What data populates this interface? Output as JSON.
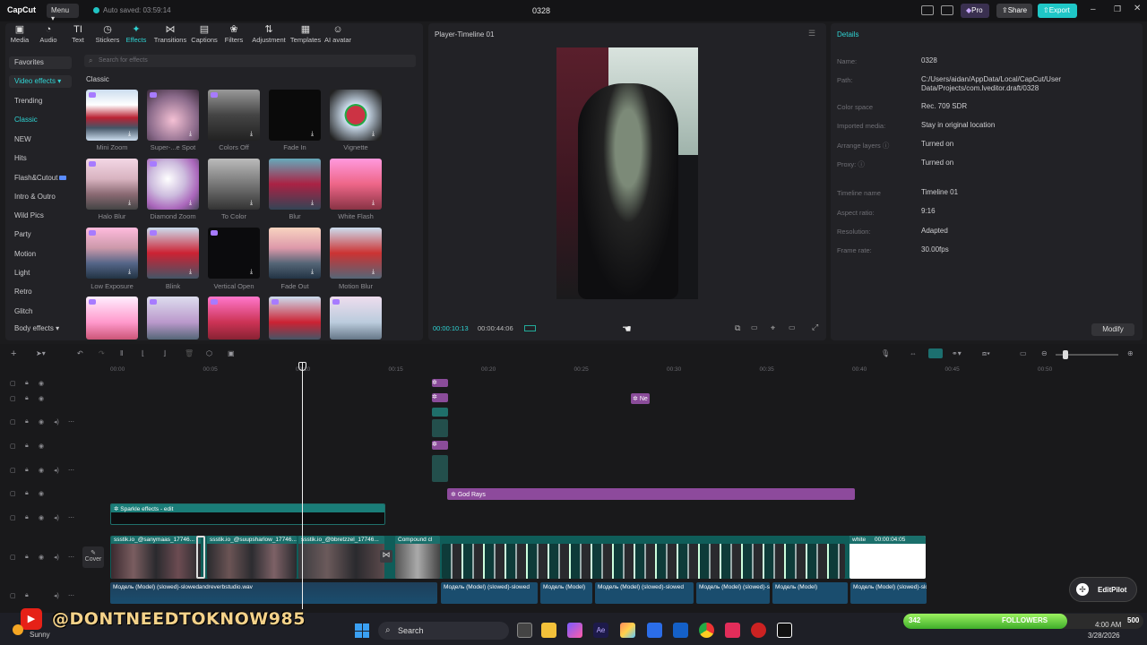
{
  "app": {
    "logo": "CapCut",
    "menu_label": "Menu",
    "autosave": "Auto saved: 03:59:14",
    "project_title": "0328",
    "pro_label": "Pro",
    "share_label": "Share",
    "export_label": "Export"
  },
  "toolbar": [
    {
      "label": "Media",
      "icon": "media-icon"
    },
    {
      "label": "Audio",
      "icon": "audio-icon"
    },
    {
      "label": "Text",
      "icon": "text-icon"
    },
    {
      "label": "Stickers",
      "icon": "stickers-icon"
    },
    {
      "label": "Effects",
      "icon": "effects-icon"
    },
    {
      "label": "Transitions",
      "icon": "transitions-icon"
    },
    {
      "label": "Captions",
      "icon": "captions-icon"
    },
    {
      "label": "Filters",
      "icon": "filters-icon"
    },
    {
      "label": "Adjustment",
      "icon": "adjustment-icon"
    },
    {
      "label": "Templates",
      "icon": "templates-icon"
    },
    {
      "label": "AI avatar",
      "icon": "ai-avatar-icon"
    }
  ],
  "sidebar": [
    "Favorites",
    "Video effects",
    "Trending",
    "Classic",
    "NEW",
    "Hits",
    "Flash&Cutout",
    "Intro & Outro",
    "Wild Pics",
    "Party",
    "Motion",
    "Light",
    "Retro",
    "Glitch",
    "Body effects"
  ],
  "effects": {
    "search_placeholder": "Search for effects",
    "section": "Classic",
    "items": [
      "Mini Zoom",
      "Super-...e Spot",
      "Colors Off",
      "Fade In",
      "Vignette",
      "Halo Blur",
      "Diamond Zoom",
      "To Color",
      "Blur",
      "White Flash",
      "Low Exposure",
      "Blink",
      "Vertical Open",
      "Fade Out",
      "Motion Blur",
      "",
      "",
      "",
      "",
      ""
    ]
  },
  "player": {
    "title": "Player-Timeline 01",
    "current_time": "00:00:10:13",
    "total_time": "00:00:44:06"
  },
  "details": {
    "title": "Details",
    "rows": [
      {
        "k": "Name:",
        "v": "0328"
      },
      {
        "k": "Path:",
        "v": "C:/Users/aidan/AppData/Local/CapCut/User Data/Projects/com.lveditor.draft/0328"
      },
      {
        "k": "Color space",
        "v": "Rec. 709 SDR"
      },
      {
        "k": "Imported media:",
        "v": "Stay in original location"
      },
      {
        "k": "Arrange layers",
        "v": "Turned on"
      },
      {
        "k": "Proxy:",
        "v": "Turned on"
      },
      {
        "k": "Timeline name",
        "v": "Timeline 01"
      },
      {
        "k": "Aspect ratio:",
        "v": "9:16"
      },
      {
        "k": "Resolution:",
        "v": "Adapted"
      },
      {
        "k": "Frame rate:",
        "v": "30.00fps"
      }
    ],
    "modify_label": "Modify"
  },
  "ruler": [
    "00:00",
    "00:05",
    "00:10",
    "00:15",
    "00:20",
    "00:25",
    "00:30",
    "00:35",
    "00:40",
    "00:45",
    "00:50"
  ],
  "timeline": {
    "god_rays": "God Rays",
    "ne_label": "Ne",
    "sparkle": "Sparkle effects - edit",
    "clip1": "ssstik.io_@sanymaas_17746...",
    "clip2": "ssstik.io_@suupsharlow_17746...",
    "clip3": "ssstik.io_@bbretzzel_17746...",
    "compound": "Compound cl",
    "white_clip": "white",
    "white_dur": "00:00:04:05",
    "audio1": "Модель (Model) (slowed)-slowedandreverbstudio.wav",
    "audio_short": "Модель (Model) (slowed)-slowed",
    "audio_s2": "Модель (Model)",
    "cover": "Cover"
  },
  "overlay": {
    "watermark": "@DONTNEEDTOKNOW985",
    "followers_count": "342",
    "followers_label": "FOLLOWERS",
    "followers_goal": "500",
    "editpilot": "EditPilot"
  },
  "taskbar": {
    "weather": "Sunny",
    "search": "Search",
    "time": "4:00 AM",
    "date": "3/28/2026"
  }
}
